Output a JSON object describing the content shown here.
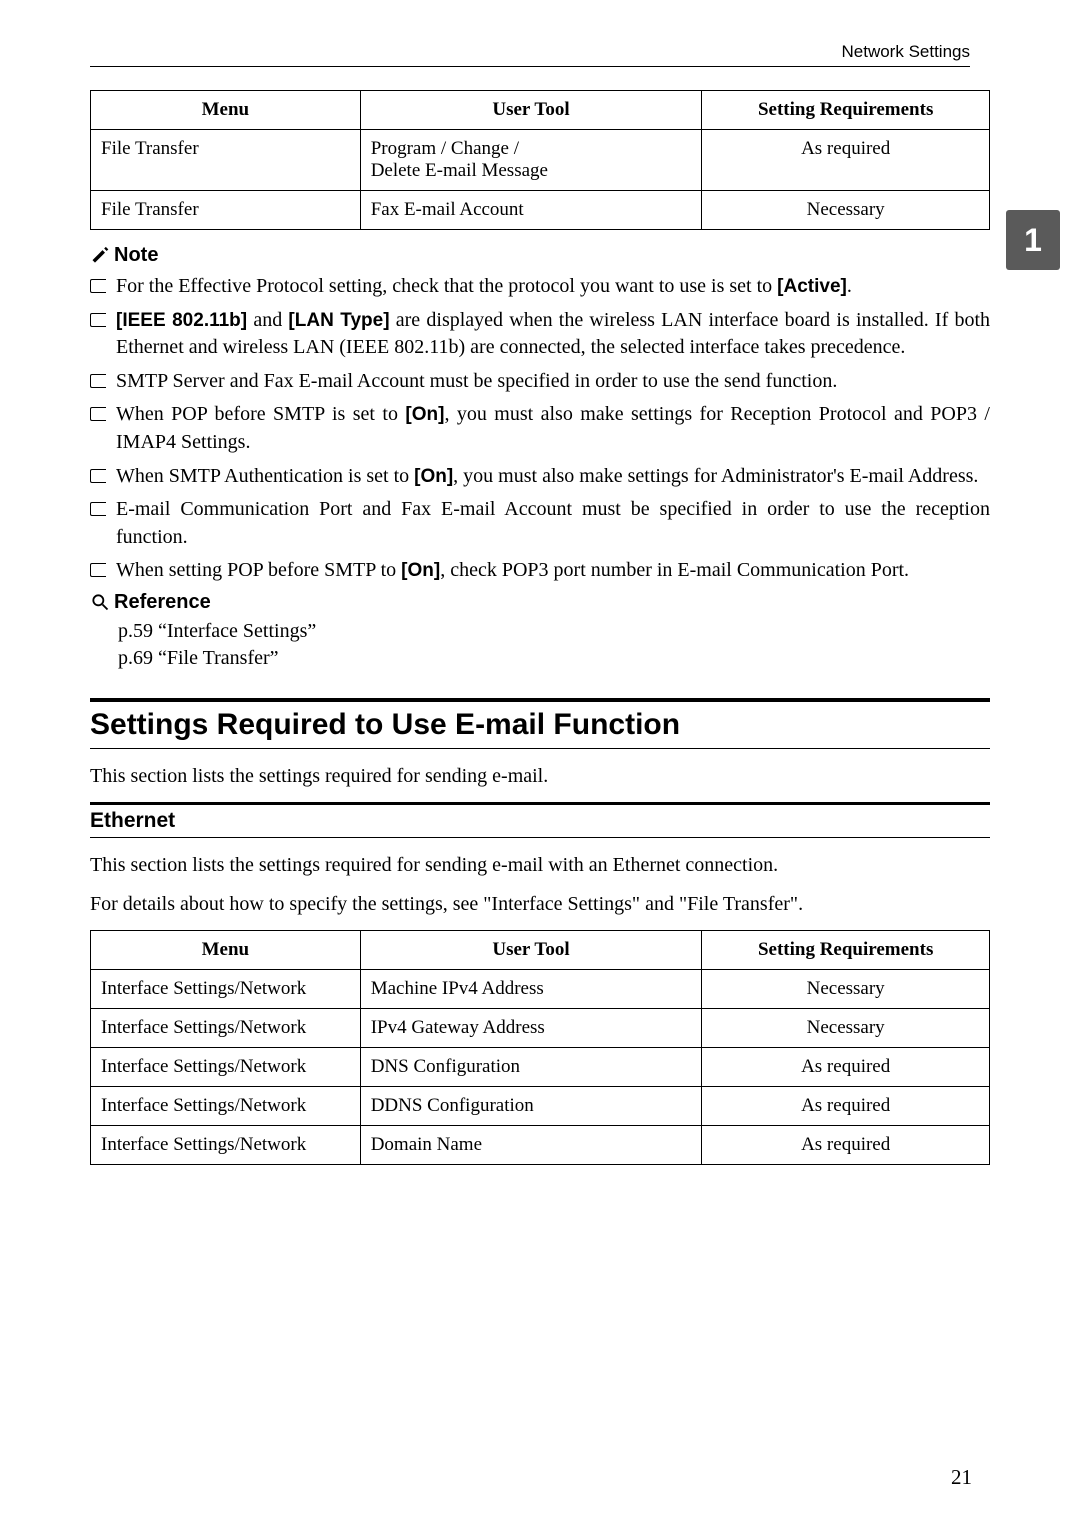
{
  "header": {
    "right": "Network Settings"
  },
  "side_tab": "1",
  "table1": {
    "headers": [
      "Menu",
      "User Tool",
      "Setting Requirements"
    ],
    "rows": [
      {
        "menu": "File Transfer",
        "tool": "Program / Change /\nDelete E-mail Message",
        "req": "As required"
      },
      {
        "menu": "File Transfer",
        "tool": "Fax E-mail Account",
        "req": "Necessary"
      }
    ]
  },
  "note_label": "Note",
  "notes": {
    "n1a": "For the Effective Protocol setting, check that the protocol you want to use is set to ",
    "n1b": "[Active]",
    "n1c": ".",
    "n2a": "[IEEE 802.11b]",
    "n2b": " and ",
    "n2c": "[LAN Type]",
    "n2d": " are displayed when the wireless LAN interface board is installed. If both Ethernet and wireless LAN (IEEE 802.11b) are connected, the selected interface takes precedence.",
    "n3": "SMTP Server and Fax E-mail Account must be specified in order to use the send function.",
    "n4a": "When POP before SMTP is set to ",
    "n4b": "[On]",
    "n4c": ", you must also make settings for Reception Protocol and POP3 / IMAP4 Settings.",
    "n5a": "When SMTP Authentication is set to ",
    "n5b": "[On]",
    "n5c": ", you must also make settings for Administrator's E-mail Address.",
    "n6": "E-mail Communication Port and Fax E-mail Account must be specified in order to use the reception function.",
    "n7a": "When setting POP before SMTP to ",
    "n7b": "[On]",
    "n7c": ", check POP3 port number in E-mail Communication Port."
  },
  "reference_label": "Reference",
  "references": [
    "p.59 “Interface Settings”",
    "p.69 “File Transfer”"
  ],
  "section_title": "Settings Required to Use E-mail Function",
  "section_intro": "This section lists the settings required for sending e-mail.",
  "subsection_title": "Ethernet",
  "sub_p1": "This section lists the settings required for sending e-mail with an Ethernet connection.",
  "sub_p2": "For details about how to specify the settings, see \"Interface Settings\" and \"File Transfer\".",
  "table2": {
    "headers": [
      "Menu",
      "User Tool",
      "Setting Requirements"
    ],
    "rows": [
      {
        "menu": "Interface Settings/Network",
        "tool": "Machine IPv4 Address",
        "req": "Necessary"
      },
      {
        "menu": "Interface Settings/Network",
        "tool": "IPv4 Gateway Address",
        "req": "Necessary"
      },
      {
        "menu": "Interface Settings/Network",
        "tool": "DNS Configuration",
        "req": "As required"
      },
      {
        "menu": "Interface Settings/Network",
        "tool": "DDNS Configuration",
        "req": "As required"
      },
      {
        "menu": "Interface Settings/Network",
        "tool": "Domain Name",
        "req": "As required"
      }
    ]
  },
  "page_number": "21"
}
